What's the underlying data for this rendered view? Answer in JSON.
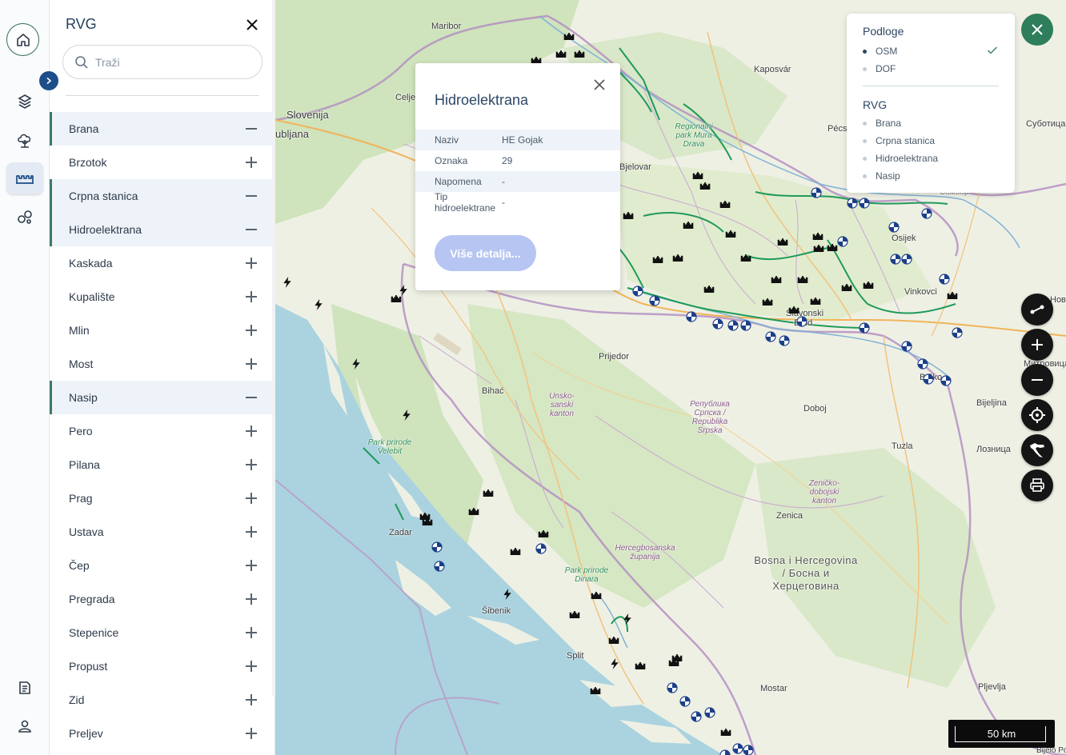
{
  "panel": {
    "title": "RVG",
    "search_placeholder": "Traži",
    "categories": [
      {
        "label": "Brana",
        "on": true
      },
      {
        "label": "Brzotok",
        "on": false
      },
      {
        "label": "Crpna stanica",
        "on": true
      },
      {
        "label": "Hidroelektrana",
        "on": true
      },
      {
        "label": "Kaskada",
        "on": false
      },
      {
        "label": "Kupalište",
        "on": false
      },
      {
        "label": "Mlin",
        "on": false
      },
      {
        "label": "Most",
        "on": false
      },
      {
        "label": "Nasip",
        "on": true
      },
      {
        "label": "Pero",
        "on": false
      },
      {
        "label": "Pilana",
        "on": false
      },
      {
        "label": "Prag",
        "on": false
      },
      {
        "label": "Ustava",
        "on": false
      },
      {
        "label": "Čep",
        "on": false
      },
      {
        "label": "Pregrada",
        "on": false
      },
      {
        "label": "Stepenice",
        "on": false
      },
      {
        "label": "Propust",
        "on": false
      },
      {
        "label": "Zid",
        "on": false
      },
      {
        "label": "Preljev",
        "on": false
      }
    ]
  },
  "rail": {
    "items": [
      "home-icon",
      "layers-icon",
      "cloud-tree-icon",
      "structure-icon",
      "circles-icon",
      "document-icon",
      "user-icon"
    ],
    "active": "structure-icon"
  },
  "popup": {
    "title": "Hidroelektrana",
    "attributes": [
      {
        "key": "Naziv",
        "value": "HE Gojak"
      },
      {
        "key": "Oznaka",
        "value": "29"
      },
      {
        "key": "Napomena",
        "value": "-"
      },
      {
        "key": "Tip hidroelektrane",
        "value": "-"
      }
    ],
    "button_label": "Više detalja..."
  },
  "layers": {
    "base_title": "Podloge",
    "base": [
      {
        "label": "OSM",
        "selected": true
      },
      {
        "label": "DOF",
        "selected": false
      }
    ],
    "rvg_title": "RVG",
    "rvg": [
      "Brana",
      "Crpna stanica",
      "Hidroelektrana",
      "Nasip"
    ]
  },
  "map": {
    "scale_label": "50 km",
    "places": {
      "maribor": "Maribor",
      "kaposvar": "Kaposvár",
      "slovenija": "Slovenija",
      "ljubljana": "ubljana",
      "celje": "Celje",
      "pecs": "Pécs",
      "subotica": "Суботица",
      "sombor": "Сомбор",
      "bjelovar": "Bjelovar",
      "osijek": "Osijek",
      "vinkovci": "Vinkovci",
      "novi": "Нови",
      "prijedor": "Prijedor",
      "bihac": "Bihać",
      "brod": "Brod",
      "slavonski": "Slavonski",
      "brcko": "Brčko",
      "mitrovica": "Митровица",
      "bijeljina": "Bijeljina",
      "doboj": "Doboj",
      "tuzla": "Tuzla",
      "loznica": "Лозница",
      "zadar": "Zadar",
      "zenica": "Zenica",
      "sibenik": "Šibenik",
      "split": "Split",
      "mostar": "Mostar",
      "pljevlja": "Pljevlja",
      "bijelo_polje": "Bijelo Po",
      "bosna": "Bosna i Hercegovina / Босна и Херцеговина",
      "park_mura": "Regionalni park Mura Drava",
      "park_velebit": "Park prirode Velebit",
      "park_dinara": "Park prirode Dinara",
      "una_sana": "Unsko-sanski kanton",
      "srpska": "Република Српска / Republika Srpska",
      "hercegbosanska": "Hercegbosanska županija",
      "zenicko": "Zeničko-dobojski kanton"
    }
  },
  "colors": {
    "accent_green": "#2e7d5b",
    "accent_blue": "#1c4e8a",
    "active_band": "#eef3f9"
  }
}
